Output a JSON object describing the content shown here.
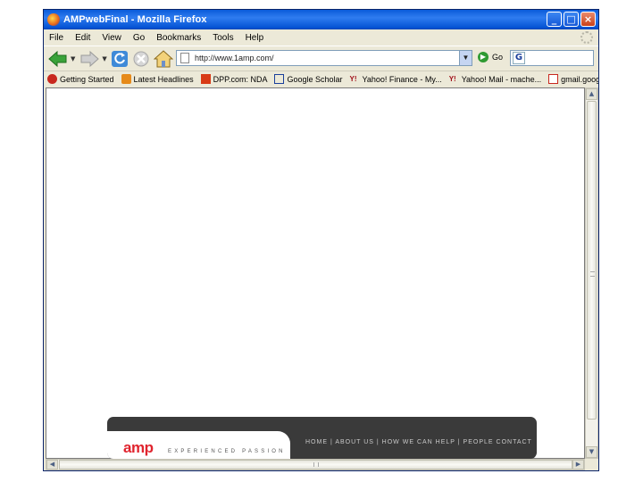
{
  "window": {
    "title": "AMPwebFinal - Mozilla Firefox",
    "buttons": {
      "minimize": "_",
      "maximize": "□",
      "close": "×"
    }
  },
  "menubar": {
    "items": [
      "File",
      "Edit",
      "View",
      "Go",
      "Bookmarks",
      "Tools",
      "Help"
    ]
  },
  "navbar": {
    "url": "http://www.1amp.com/",
    "go_label": "Go",
    "icons": [
      "back-arrow-icon",
      "forward-arrow-icon",
      "reload-icon",
      "stop-icon",
      "home-icon"
    ]
  },
  "bookmarks": [
    {
      "label": "Getting Started",
      "icon": "firefox-icon",
      "color": "#c8281e"
    },
    {
      "label": "Latest Headlines",
      "icon": "rss-icon",
      "color": "#e68a1a"
    },
    {
      "label": "DPP.com: NDA",
      "icon": "dpp-icon",
      "color": "#d83a16"
    },
    {
      "label": "Google Scholar",
      "icon": "google-icon",
      "color": "#1a3f9b"
    },
    {
      "label": "Yahoo! Finance - My...",
      "icon": "yahoo-icon",
      "color": "#a0101a"
    },
    {
      "label": "Yahoo! Mail - mache...",
      "icon": "yahoo-icon",
      "color": "#a0101a"
    },
    {
      "label": "gmail.google.com",
      "icon": "gmail-icon",
      "color": "#c8281e"
    }
  ],
  "site": {
    "logo": "amp",
    "tagline": "EXPERIENCED PASSION",
    "nav": "HOME | ABOUT US | HOW WE CAN HELP | PEOPLE   CONTACT",
    "colors": {
      "banner": "#3a3a3a",
      "logo": "#e0242e"
    }
  }
}
